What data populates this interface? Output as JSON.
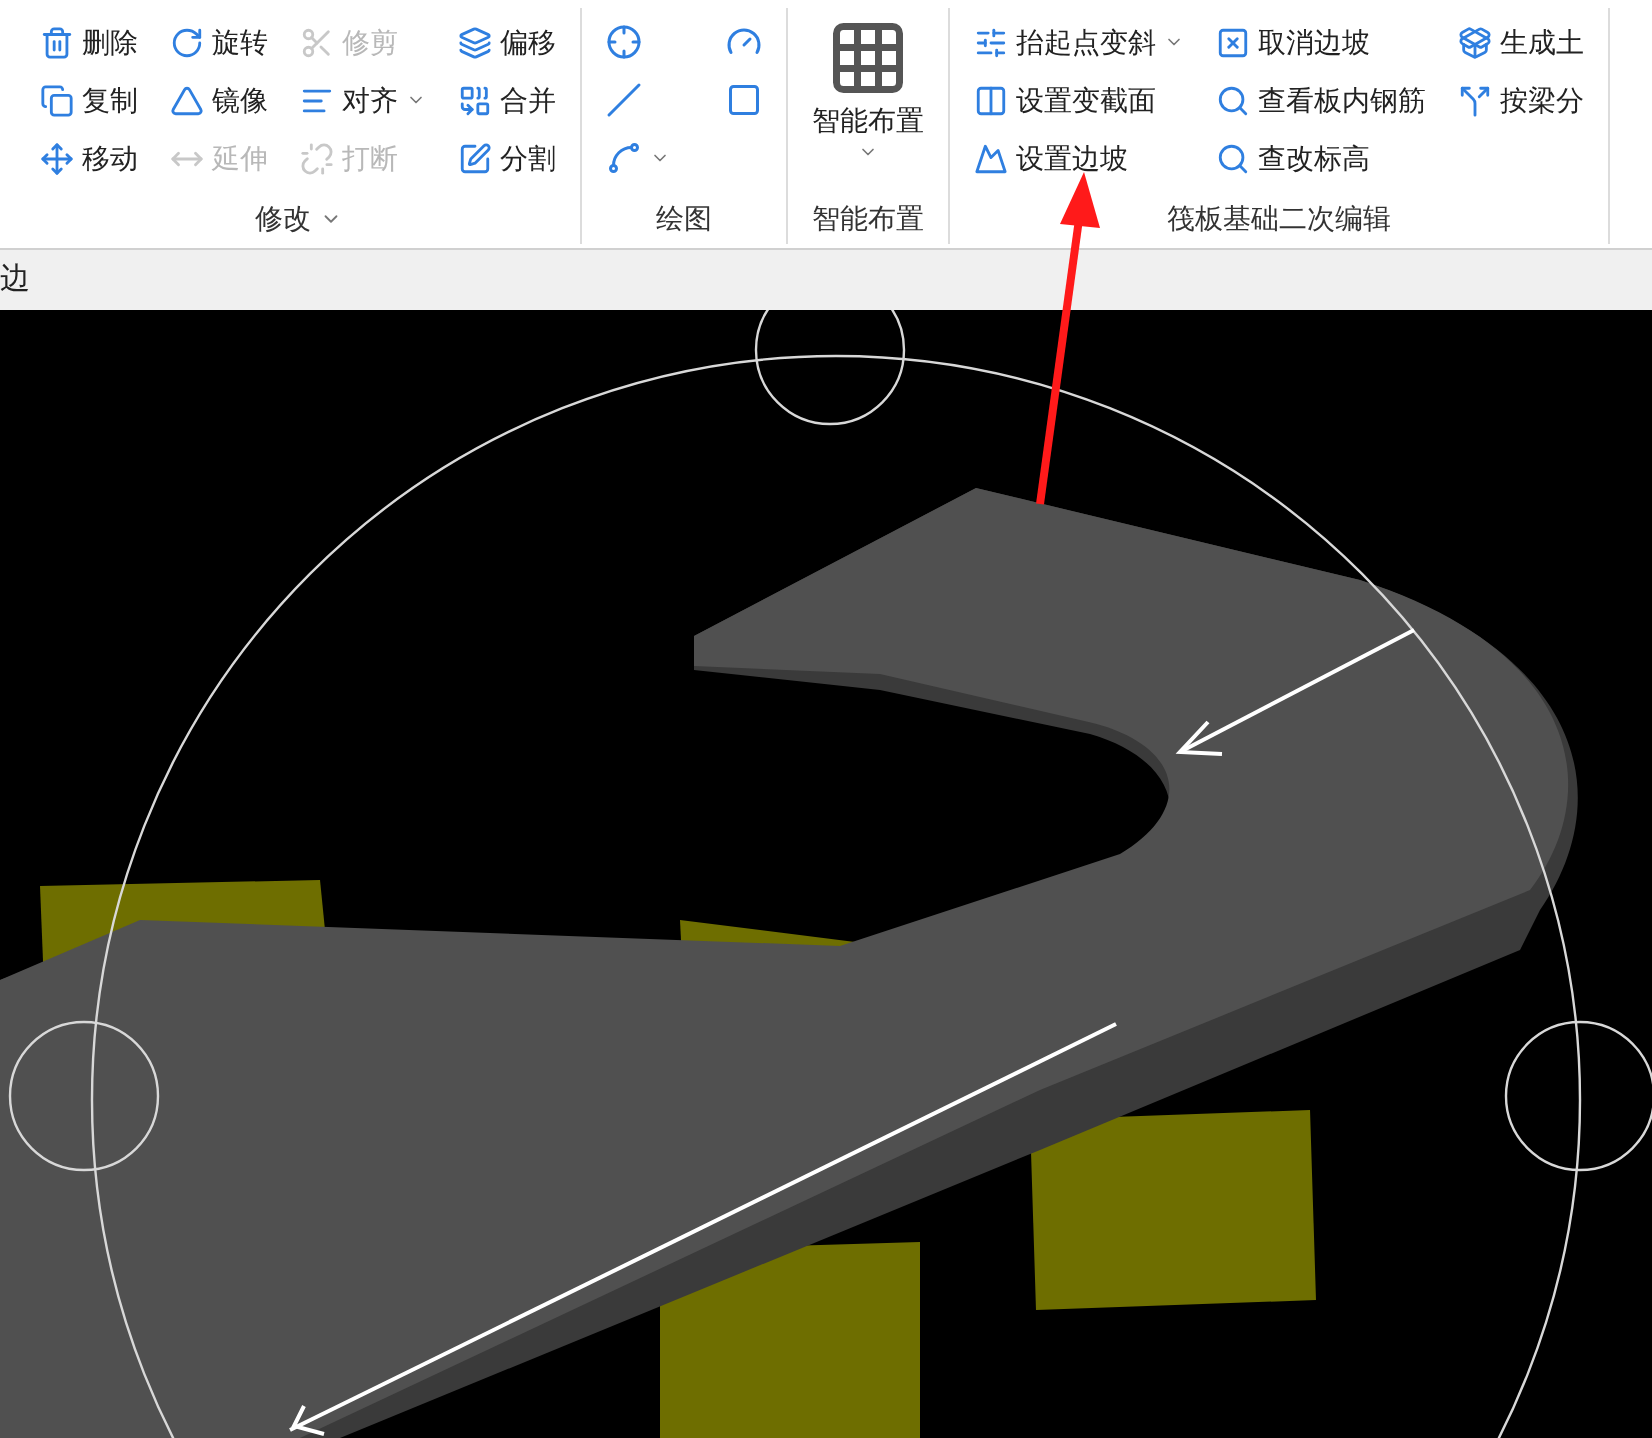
{
  "ribbon": {
    "groups": [
      {
        "label": "修改",
        "has_menu": true,
        "kind": "grid",
        "items": [
          {
            "label": "删除",
            "disabled": false,
            "dropdown": false
          },
          {
            "label": "复制",
            "disabled": false,
            "dropdown": false
          },
          {
            "label": "移动",
            "disabled": false,
            "dropdown": false
          },
          {
            "label": "旋转",
            "disabled": false,
            "dropdown": false
          },
          {
            "label": "镜像",
            "disabled": false,
            "dropdown": false
          },
          {
            "label": "延伸",
            "disabled": true,
            "dropdown": false
          },
          {
            "label": "修剪",
            "disabled": true,
            "dropdown": false
          },
          {
            "label": "对齐",
            "disabled": false,
            "dropdown": true
          },
          {
            "label": "打断",
            "disabled": true,
            "dropdown": false
          },
          {
            "label": "偏移",
            "disabled": false,
            "dropdown": false
          },
          {
            "label": "合并",
            "disabled": false,
            "dropdown": false
          },
          {
            "label": "分割",
            "disabled": false,
            "dropdown": false
          }
        ]
      },
      {
        "label": "绘图",
        "has_menu": false,
        "kind": "icons",
        "items": [
          {
            "dropdown": false
          },
          {
            "dropdown": false
          },
          {
            "dropdown": true
          },
          {
            "dropdown": false
          },
          {
            "dropdown": false
          }
        ]
      },
      {
        "label": "智能布置",
        "has_menu": false,
        "kind": "big",
        "items": [
          {
            "label": "智能布置",
            "disabled": false,
            "dropdown": true
          }
        ]
      },
      {
        "label": "筏板基础二次编辑",
        "has_menu": false,
        "kind": "grid",
        "items": [
          {
            "label": "抬起点变斜",
            "disabled": false,
            "dropdown": true
          },
          {
            "label": "设置变截面",
            "disabled": false,
            "dropdown": false
          },
          {
            "label": "设置边坡",
            "disabled": false,
            "dropdown": false
          },
          {
            "label": "取消边坡",
            "disabled": false,
            "dropdown": false
          },
          {
            "label": "查看板内钢筋",
            "disabled": false,
            "dropdown": false
          },
          {
            "label": "查改标高",
            "disabled": false,
            "dropdown": false
          },
          {
            "label": "生成土",
            "disabled": false,
            "dropdown": false
          },
          {
            "label": "按梁分",
            "disabled": false,
            "dropdown": false
          }
        ]
      }
    ]
  },
  "tab_strip": {
    "tab": "边"
  },
  "annotation": {
    "kind": "arrow"
  }
}
